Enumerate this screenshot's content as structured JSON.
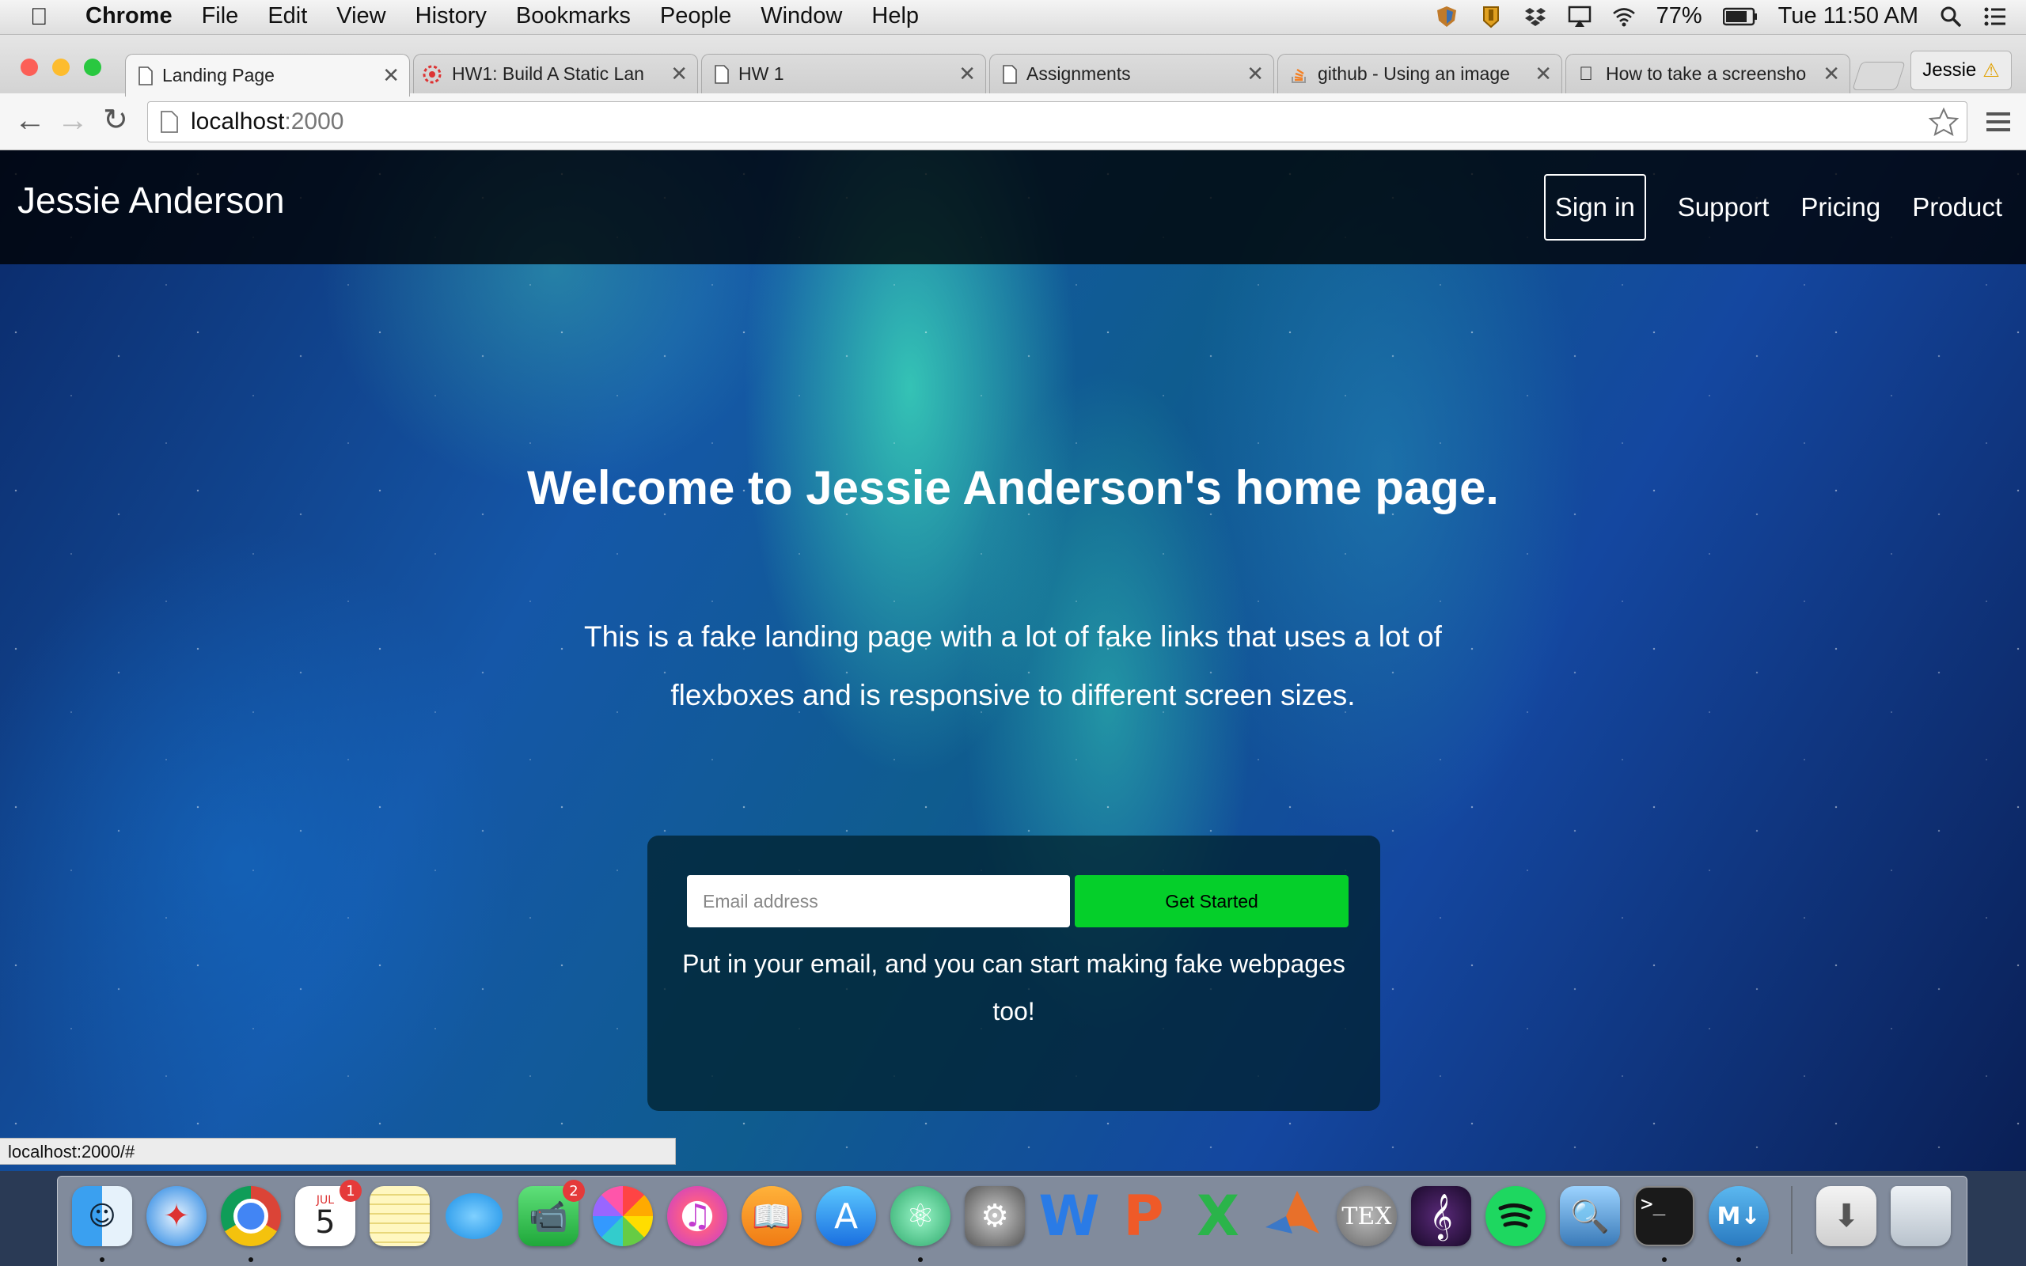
{
  "menubar": {
    "app_name": "Chrome",
    "menus": [
      "File",
      "Edit",
      "View",
      "History",
      "Bookmarks",
      "People",
      "Window",
      "Help"
    ],
    "battery": "77%",
    "clock": "Tue 11:50 AM"
  },
  "tabs": [
    {
      "title": "Landing Page",
      "icon": "page-icon",
      "active": true
    },
    {
      "title": "HW1: Build A Static Lan",
      "icon": "course-logo-icon"
    },
    {
      "title": "HW 1",
      "icon": "page-icon"
    },
    {
      "title": "Assignments",
      "icon": "page-icon"
    },
    {
      "title": "github - Using an image",
      "icon": "stackoverflow-icon"
    },
    {
      "title": "How to take a screensho",
      "icon": "apple-icon"
    }
  ],
  "profile": {
    "name": "Jessie",
    "warning": "⚠"
  },
  "address": {
    "host": "localhost",
    "port": ":2000"
  },
  "site": {
    "brand": "Jessie Anderson",
    "nav": {
      "signin": "Sign in",
      "support": "Support",
      "pricing": "Pricing",
      "product": "Product"
    },
    "hero_title": "Welcome to Jessie Anderson's home page.",
    "hero_sub": "This is a fake landing page with a lot of fake links that uses a lot of flexboxes and is responsive to different screen sizes.",
    "email_placeholder": "Email address",
    "cta": "Get Started",
    "card_text": "Put in your email, and you can start making fake webpages too!"
  },
  "status_url": "localhost:2000/#",
  "dock": {
    "calendar_month": "JUL",
    "calendar_day": "5",
    "calendar_badge": "1",
    "facetime_badge": "2",
    "items": [
      "finder-icon",
      "safari-icon",
      "chrome-icon",
      "calendar-icon",
      "notes-icon",
      "messages-icon",
      "facetime-icon",
      "photos-icon",
      "itunes-icon",
      "ibooks-icon",
      "app-store-icon",
      "atom-icon",
      "system-preferences-icon",
      "word-icon",
      "powerpoint-icon",
      "excel-icon",
      "matlab-icon",
      "tex-icon",
      "musescore-icon",
      "spotify-icon",
      "preview-icon",
      "terminal-icon",
      "markdown-icon",
      "downloads-icon",
      "trash-icon"
    ]
  },
  "colors": {
    "cta": "#05cf2a",
    "nav_bg": "#000000",
    "card_bg": "#001e28"
  }
}
